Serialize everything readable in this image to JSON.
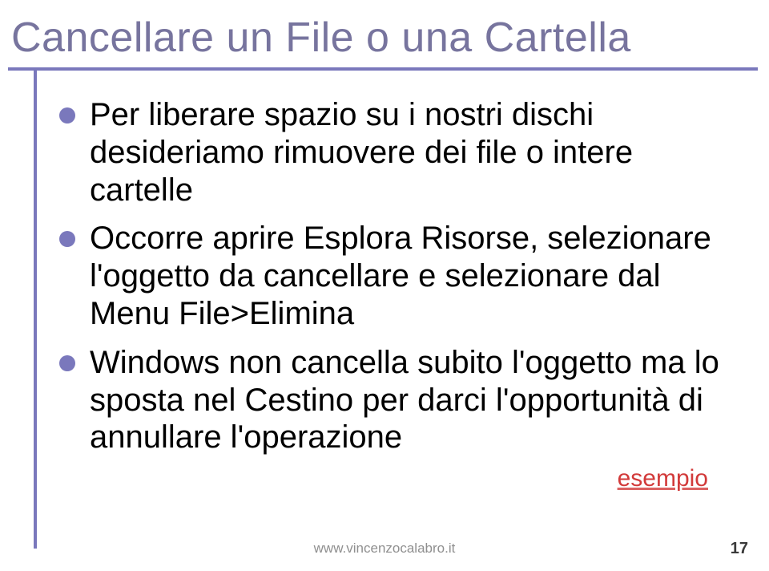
{
  "title": "Cancellare un File o una Cartella",
  "bullets": [
    "Per liberare spazio su i nostri dischi desideriamo rimuovere dei file o intere cartelle",
    "Occorre aprire Esplora Risorse, selezionare l'oggetto da cancellare e selezionare dal Menu File>Elimina",
    "Windows non cancella subito l'oggetto ma lo sposta nel Cestino per darci l'opportunità di annullare l'operazione"
  ],
  "example_label": "esempio",
  "footer_url": "www.vincenzocalabro.it",
  "page_number": "17",
  "accent_color": "#7a78bc"
}
